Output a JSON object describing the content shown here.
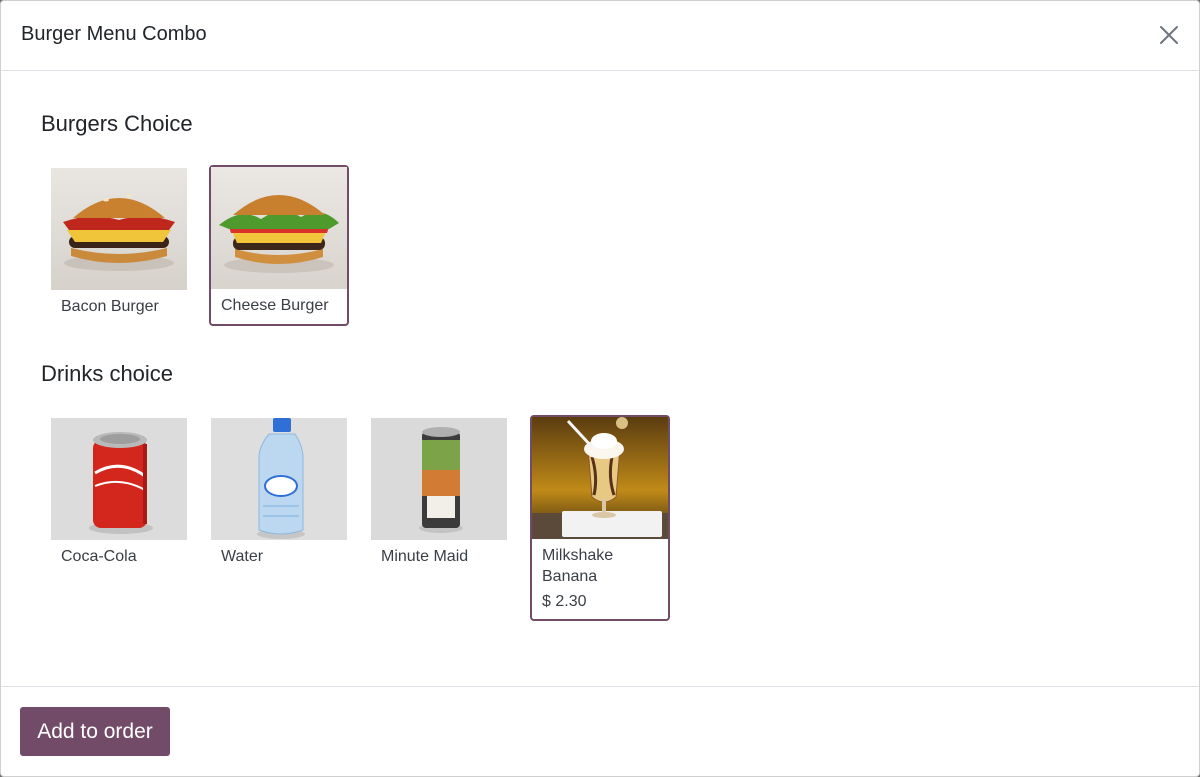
{
  "dialog": {
    "title": "Burger Menu Combo",
    "close_icon": "close-icon"
  },
  "sections": {
    "burgers": {
      "title": "Burgers Choice",
      "items": [
        {
          "name": "Bacon Burger",
          "selected": false
        },
        {
          "name": "Cheese Burger",
          "selected": true
        }
      ]
    },
    "drinks": {
      "title": "Drinks choice",
      "items": [
        {
          "name": "Coca-Cola",
          "selected": false
        },
        {
          "name": "Water",
          "selected": false
        },
        {
          "name": "Minute Maid",
          "selected": false
        },
        {
          "name": "Milkshake Banana",
          "selected": true,
          "price": "$ 2.30"
        }
      ]
    }
  },
  "footer": {
    "add_label": "Add to order"
  },
  "colors": {
    "accent": "#714b67"
  }
}
